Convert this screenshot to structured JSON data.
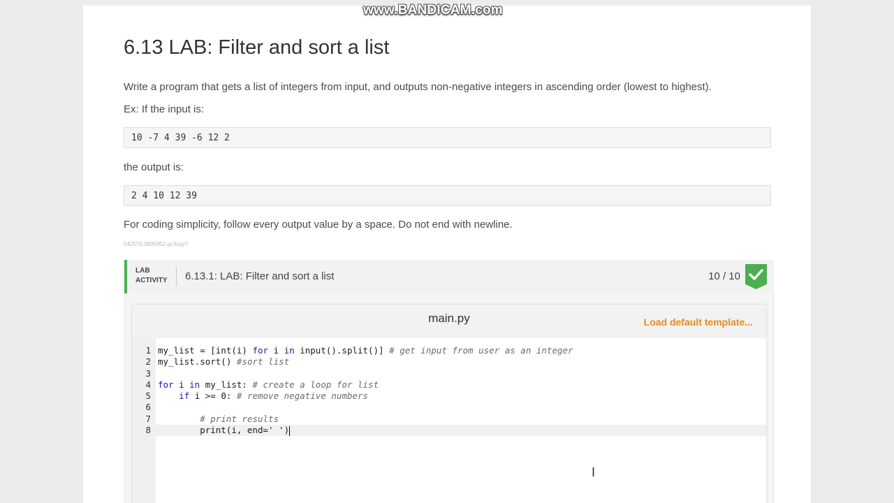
{
  "watermark": "www.BANDICAM.com",
  "title": "6.13 LAB: Filter and sort a list",
  "description": "Write a program that gets a list of integers from input, and outputs non-negative integers in ascending order (lowest to highest).",
  "example_intro": "Ex: If the input is:",
  "example_input": "10 -7 4 39 -6 12 2",
  "output_intro": "the output is:",
  "example_output": "2 4 10 12 39",
  "note": "For coding simplicity, follow every output value by a space. Do not end with newline.",
  "reference_id": "542570.3895852.qx3zqy7",
  "lab": {
    "tag_line1": "LAB",
    "tag_line2": "ACTIVITY",
    "title": "6.13.1: LAB: Filter and sort a list",
    "score": "10 / 10",
    "accent": "#4caf50"
  },
  "editor": {
    "filename": "main.py",
    "load_template": "Load default template...",
    "line_numbers": [
      "1",
      "2",
      "3",
      "4",
      "5",
      "6",
      "7",
      "8"
    ]
  }
}
